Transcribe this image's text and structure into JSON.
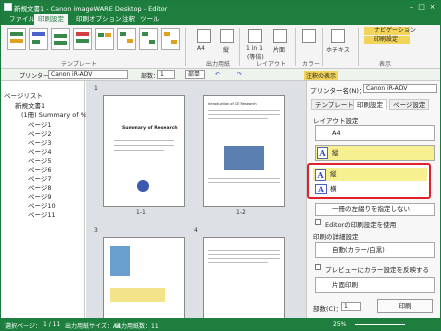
{
  "window": {
    "title": "新規文書1 - Canon imageWARE Desktop - Editor"
  },
  "menu": [
    "ファイル",
    "印刷設定",
    "印刷オプション",
    "注釈",
    "ツール"
  ],
  "ribbon": {
    "groups": [
      "テンプレート",
      "出力用紙",
      "レイアウト",
      "カラー",
      "表示"
    ],
    "buttons": {
      "paper": "A4",
      "orient": "縦",
      "nup": "1 in 1",
      "nup_sub": "(等倍)",
      "duplex": "片面",
      "staple": "ホチキス"
    },
    "nav_label": "ナビゲーション",
    "tag_label": "印刷設定"
  },
  "toolbar": {
    "printer_label": "プリンター：",
    "printer_value": "Canon iR-ADV",
    "copies_label": "部数：",
    "copies_value": "1",
    "order_value": "部単",
    "annot_label": "注釈の表示",
    "zoom": "25%"
  },
  "left": {
    "title": "ページリスト",
    "tree": [
      "新規文書1",
      "(1冊) Summary of %",
      "ページ1",
      "ページ2",
      "ページ3",
      "ページ4",
      "ページ5",
      "ページ6",
      "ページ7",
      "ページ8",
      "ページ9",
      "ページ10",
      "ページ11"
    ]
  },
  "pages": [
    {
      "num": "1",
      "label": "1-1",
      "title": "Summary of Research"
    },
    {
      "num": "",
      "label": "1-2",
      "title": "Introduction of CE Research"
    },
    {
      "num": "3",
      "label": "",
      "": ""
    },
    {
      "num": "4",
      "label": ""
    }
  ],
  "right": {
    "printer_label": "プリンター名(N)：",
    "printer_value": "Canon iR-ADV",
    "tabs": [
      "テンプレート",
      "印刷設定",
      "ページ設定"
    ],
    "layout_title": "レイアウト設定",
    "paper_value": "A4",
    "orient_value": "縦",
    "options": [
      "縦",
      "横"
    ],
    "binding_value": "一冊の左綴りを指定しない",
    "check1": "Editorの印刷設定を使用",
    "color_title": "印刷の詳細設定",
    "color_value": "自動(カラー/白黒)",
    "check2": "プレビューにカラー設定を反映する",
    "duplex_value": "片面印刷",
    "copies_label": "部数(C)：",
    "copies_value": "1",
    "print_btn": "印刷"
  },
  "status": {
    "items": [
      "選択ページ：",
      "1 / 11",
      "出力用紙サイズ：A4",
      "出力用紙数：11"
    ],
    "zoom": "25%"
  }
}
